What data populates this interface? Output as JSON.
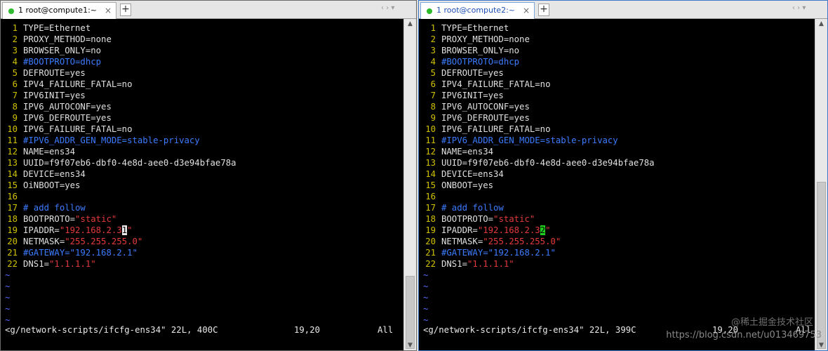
{
  "left": {
    "tab_label": "1 root@compute1:~",
    "close": "×",
    "add": "+",
    "nav": "‹  ›  ▾",
    "status_file": "<g/network-scripts/ifcfg-ens34\" 22L, 400C",
    "status_pos": "19,20",
    "status_all": "All",
    "lines": {
      "1": {
        "n": "1",
        "a": "TYPE=Ethernet"
      },
      "2": {
        "n": "2",
        "a": "PROXY_METHOD=none"
      },
      "3": {
        "n": "3",
        "a": "BROWSER_ONLY=no"
      },
      "4": {
        "n": "4",
        "c": "#BOOTPROTO=dhcp"
      },
      "5": {
        "n": "5",
        "a": "DEFROUTE=yes"
      },
      "6": {
        "n": "6",
        "a": "IPV4_FAILURE_FATAL=no"
      },
      "7": {
        "n": "7",
        "a": "IPV6INIT=yes"
      },
      "8": {
        "n": "8",
        "a": "IPV6_AUTOCONF=yes"
      },
      "9": {
        "n": "9",
        "a": "IPV6_DEFROUTE=yes"
      },
      "10": {
        "n": "10",
        "a": "IPV6_FAILURE_FATAL=no"
      },
      "11": {
        "n": "11",
        "c": "#IPV6_ADDR_GEN_MODE=stable-privacy"
      },
      "12": {
        "n": "12",
        "a": "NAME=ens34"
      },
      "13": {
        "n": "13",
        "a": "UUID=f9f07eb6-dbf0-4e8d-aee0-d3e94bfae78a"
      },
      "14": {
        "n": "14",
        "a": "DEVICE=ens34"
      },
      "15": {
        "n": "15",
        "a": "OiNBOOT=yes"
      },
      "16": {
        "n": "16",
        "a": ""
      },
      "17": {
        "n": "17",
        "c": "# add follow"
      },
      "18": {
        "n": "18",
        "a": "BOOTPROTO=",
        "s": "\"static\""
      },
      "19": {
        "n": "19",
        "a": "IPADDR=",
        "s": "\"192.168.2.3",
        "cur": "1",
        "s2": "\""
      },
      "20": {
        "n": "20",
        "a": "NETMASK=",
        "s": "\"255.255.255.0\""
      },
      "21": {
        "n": "21",
        "c": "#GATEWAY=\"192.168.2.1\""
      },
      "22": {
        "n": "22",
        "a": "DNS1=",
        "s": "\"1.1.1.1\""
      }
    }
  },
  "right": {
    "tab_label": "1 root@compute2:~",
    "close": "×",
    "add": "+",
    "nav": "‹  ›  ▾",
    "status_file": "<g/network-scripts/ifcfg-ens34\" 22L, 399C",
    "status_pos": "19,20",
    "status_all": "All",
    "watermark_top": "@稀土掘金技术社区",
    "watermark": "https://blog.csdn.net/u013469753",
    "lines": {
      "1": {
        "n": "1",
        "a": "TYPE=Ethernet"
      },
      "2": {
        "n": "2",
        "a": "PROXY_METHOD=none"
      },
      "3": {
        "n": "3",
        "a": "BROWSER_ONLY=no"
      },
      "4": {
        "n": "4",
        "c": "#BOOTPROTO=dhcp"
      },
      "5": {
        "n": "5",
        "a": "DEFROUTE=yes"
      },
      "6": {
        "n": "6",
        "a": "IPV4_FAILURE_FATAL=no"
      },
      "7": {
        "n": "7",
        "a": "IPV6INIT=yes"
      },
      "8": {
        "n": "8",
        "a": "IPV6_AUTOCONF=yes"
      },
      "9": {
        "n": "9",
        "a": "IPV6_DEFROUTE=yes"
      },
      "10": {
        "n": "10",
        "a": "IPV6_FAILURE_FATAL=no"
      },
      "11": {
        "n": "11",
        "c": "#IPV6_ADDR_GEN_MODE=stable-privacy"
      },
      "12": {
        "n": "12",
        "a": "NAME=ens34"
      },
      "13": {
        "n": "13",
        "a": "UUID=f9f07eb6-dbf0-4e8d-aee0-d3e94bfae78a"
      },
      "14": {
        "n": "14",
        "a": "DEVICE=ens34"
      },
      "15": {
        "n": "15",
        "a": "ONBOOT=yes"
      },
      "16": {
        "n": "16",
        "a": ""
      },
      "17": {
        "n": "17",
        "c": "# add follow"
      },
      "18": {
        "n": "18",
        "a": "BOOTPROTO=",
        "s": "\"static\""
      },
      "19": {
        "n": "19",
        "a": "IPADDR=",
        "s": "\"192.168.2.3",
        "cur": "2",
        "s2": "\""
      },
      "20": {
        "n": "20",
        "a": "NETMASK=",
        "s": "\"255.255.255.0\""
      },
      "21": {
        "n": "21",
        "c": "#GATEWAY=\"192.168.2.1\""
      },
      "22": {
        "n": "22",
        "a": "DNS1=",
        "s": "\"1.1.1.1\""
      }
    }
  },
  "tilde": "~",
  "icons": {
    "scroll_up": "▲",
    "scroll_down": "▼",
    "tab_status": "session-connected-icon"
  },
  "colors": {
    "line_number": "#d0c000",
    "comment": "#3c7cff",
    "string": "#e23a3a",
    "cursor_right": "#1ecf1e"
  }
}
